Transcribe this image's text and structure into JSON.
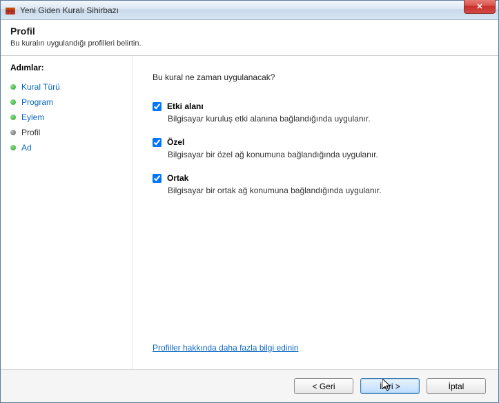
{
  "window": {
    "title": "Yeni Giden Kuralı Sihirbazı"
  },
  "header": {
    "title": "Profil",
    "subtitle": "Bu kuralın uygulandığı profilleri belirtin."
  },
  "sidebar": {
    "steps_label": "Adımlar:",
    "steps": [
      {
        "label": "Kural Türü",
        "current": false
      },
      {
        "label": "Program",
        "current": false
      },
      {
        "label": "Eylem",
        "current": false
      },
      {
        "label": "Profil",
        "current": true
      },
      {
        "label": "Ad",
        "current": false
      }
    ]
  },
  "content": {
    "question": "Bu kural ne zaman uygulanacak?",
    "options": [
      {
        "label": "Etki alanı",
        "desc": "Bilgisayar kuruluş etki alanına bağlandığında uygulanır.",
        "checked": true
      },
      {
        "label": "Özel",
        "desc": "Bilgisayar bir özel ağ konumuna bağlandığında uygulanır.",
        "checked": true
      },
      {
        "label": "Ortak",
        "desc": "Bilgisayar bir ortak ağ konumuna bağlandığında uygulanır.",
        "checked": true
      }
    ],
    "more_link": "Profiller hakkında daha fazla bilgi edinin"
  },
  "footer": {
    "back": "< Geri",
    "next": "İleri >",
    "cancel": "İptal"
  }
}
